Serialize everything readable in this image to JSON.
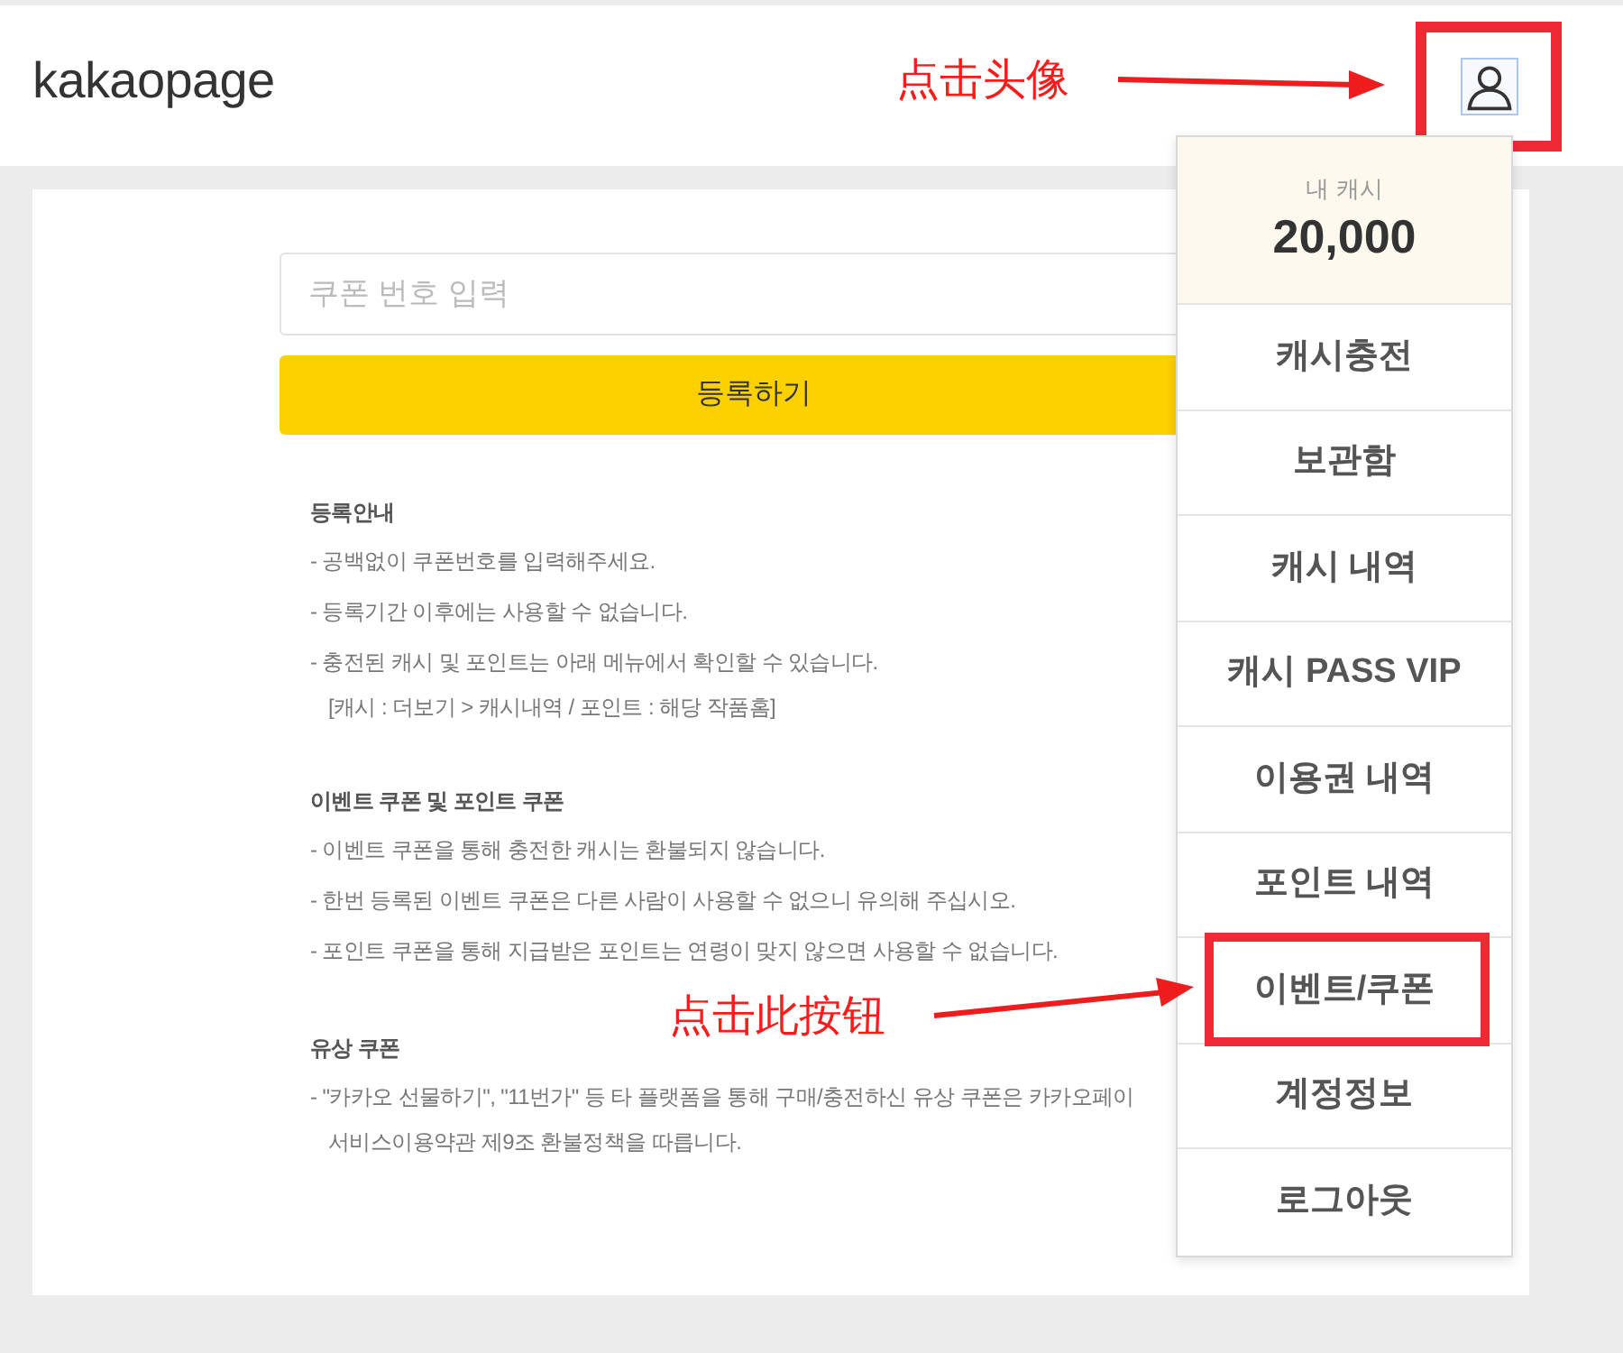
{
  "header": {
    "logo": "kakaopage",
    "callout": "点击头像",
    "avatar": {
      "boxed": true
    }
  },
  "coupon_form": {
    "placeholder": "쿠폰 번호 입력",
    "submit": "등록하기"
  },
  "notices": [
    {
      "title": "등록안내",
      "lines": [
        {
          "kind": "bullet",
          "text": "- 공백없이 쿠폰번호를 입력해주세요."
        },
        {
          "kind": "bullet",
          "text": "- 등록기간 이후에는 사용할 수 없습니다."
        },
        {
          "kind": "bullet",
          "text": "- 충전된 캐시 및 포인트는 아래 메뉴에서 확인할 수 있습니다."
        },
        {
          "kind": "continuation",
          "text": "[캐시 : 더보기 > 캐시내역 / 포인트 : 해당 작품홈]"
        }
      ]
    },
    {
      "title": "이벤트 쿠폰 및 포인트 쿠폰",
      "lines": [
        {
          "kind": "bullet",
          "text": "- 이벤트 쿠폰을 통해 충전한 캐시는 환불되지 않습니다."
        },
        {
          "kind": "bullet",
          "text": "- 한번 등록된 이벤트 쿠폰은 다른 사람이 사용할 수 없으니 유의해 주십시오."
        },
        {
          "kind": "bullet",
          "text": "- 포인트 쿠폰을 통해 지급받은 포인트는 연령이 맞지 않으면 사용할 수 없습니다."
        }
      ]
    },
    {
      "title": "유상 쿠폰",
      "lines": [
        {
          "kind": "bullet",
          "text": "- \"카카오 선물하기\", \"11번가\" 등 타 플랫폼을 통해 구매/충전하신 유상 쿠폰은 카카오페이"
        },
        {
          "kind": "continuation",
          "text": "서비스이용약관 제9조 환불정책을 따릅니다."
        }
      ]
    }
  ],
  "menu": {
    "cash_label": "내 캐시",
    "cash_amount": "20,000",
    "callout": "点击此按钮",
    "items": [
      {
        "label": "캐시충전",
        "boxed": false
      },
      {
        "label": "보관함",
        "boxed": false
      },
      {
        "label": "캐시 내역",
        "boxed": false
      },
      {
        "label": "캐시 PASS VIP",
        "boxed": false
      },
      {
        "label": "이용권 내역",
        "boxed": false
      },
      {
        "label": "포인트 내역",
        "boxed": false
      },
      {
        "label": "이벤트/쿠폰",
        "boxed": true
      },
      {
        "label": "계정정보",
        "boxed": false
      },
      {
        "label": "로그아웃",
        "boxed": false
      }
    ]
  }
}
